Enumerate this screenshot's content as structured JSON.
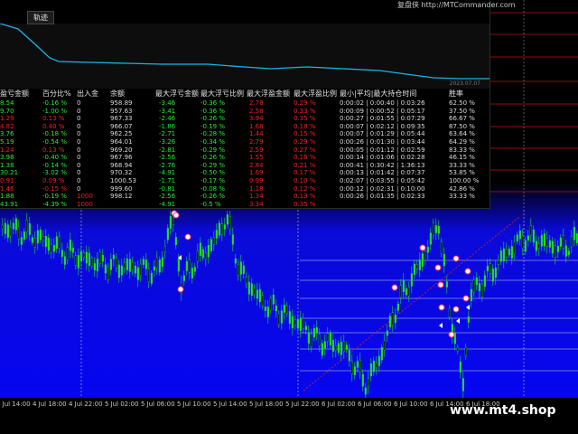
{
  "panel": {
    "title_tab": "轨迹",
    "brand": "复盘侠 http://MTCommander.com",
    "curve_date": "2023.07.07"
  },
  "stats": {
    "headers": [
      "盈亏金额",
      "百分比%",
      "出入金",
      "余额",
      "最大浮亏金额",
      "最大浮亏比例",
      "最大浮盈金额",
      "最大浮盈比例",
      "最小|平均|最大持仓时间",
      "胜率"
    ],
    "rows": [
      {
        "pl": "8.54",
        "pct": "-0.16 %",
        "io": "0",
        "bal": "958.89",
        "mfl": "-3.46",
        "mflp": "-0.36 %",
        "mfp": "2.78",
        "mfpp": "0.29 %",
        "time": "0:00:02 | 0:00:40 | 0:03:26",
        "win": "62.50 %",
        "pl_c": "green",
        "pct_c": "green"
      },
      {
        "pl": "9.70",
        "pct": "-1.00 %",
        "io": "0",
        "bal": "957.63",
        "mfl": "-3.41",
        "mflp": "-0.36 %",
        "mfp": "2.58",
        "mfpp": "0.33 %",
        "time": "0:00:09 | 0:00:52 | 0:05:17",
        "win": "37.50 %",
        "pl_c": "green",
        "pct_c": "green"
      },
      {
        "pl": "1.29",
        "pct": "0.13 %",
        "io": "0",
        "bal": "967.33",
        "mfl": "-2.46",
        "mflp": "-0.26 %",
        "mfp": "3.94",
        "mfpp": "0.35 %",
        "time": "0:00:27 | 0:01:55 | 0:07:29",
        "win": "66.67 %",
        "pl_c": "red",
        "pct_c": "red"
      },
      {
        "pl": "4.82",
        "pct": "0.40 %",
        "io": "0",
        "bal": "966.07",
        "mfl": "-1.86",
        "mflp": "-0.19 %",
        "mfp": "1.68",
        "mfpp": "0.18 %",
        "time": "0:00:07 | 0:02:12 | 0:09:35",
        "win": "87.50 %",
        "pl_c": "red",
        "pct_c": "red"
      },
      {
        "pl": "3.76",
        "pct": "-0.18 %",
        "io": "0",
        "bal": "962.25",
        "mfl": "-2.71",
        "mflp": "-0.28 %",
        "mfp": "1.44",
        "mfpp": "0.15 %",
        "time": "0:00:07 | 0:01:29 | 0:05:44",
        "win": "63.64 %",
        "pl_c": "green",
        "pct_c": "green"
      },
      {
        "pl": "5.19",
        "pct": "-0.54 %",
        "io": "0",
        "bal": "964.01",
        "mfl": "-3.26",
        "mflp": "-0.34 %",
        "mfp": "2.79",
        "mfpp": "0.29 %",
        "time": "0:00:26 | 0:01:30 | 0:03:44",
        "win": "64.29 %",
        "pl_c": "green",
        "pct_c": "green"
      },
      {
        "pl": "1.24",
        "pct": "0.13 %",
        "io": "0",
        "bal": "969.20",
        "mfl": "-2.81",
        "mflp": "-0.29 %",
        "mfp": "2.59",
        "mfpp": "0.27 %",
        "time": "0:00:05 | 0:01:12 | 0:02:59",
        "win": "83.33 %",
        "pl_c": "red",
        "pct_c": "red"
      },
      {
        "pl": "3.98",
        "pct": "-0.40 %",
        "io": "0",
        "bal": "967.96",
        "mfl": "-2.56",
        "mflp": "-0.26 %",
        "mfp": "1.55",
        "mfpp": "0.16 %",
        "time": "0:00:14 | 0:01:06 | 0:02:28",
        "win": "46.15 %",
        "pl_c": "green",
        "pct_c": "green"
      },
      {
        "pl": "1.38",
        "pct": "-0.14 %",
        "io": "0",
        "bal": "968.94",
        "mfl": "-2.76",
        "mflp": "-0.29 %",
        "mfp": "2.84",
        "mfpp": "0.21 %",
        "time": "0:00:41 | 0:30:42 | 1:36:13",
        "win": "33.33 %",
        "pl_c": "green",
        "pct_c": "green"
      },
      {
        "pl": "30.21",
        "pct": "-3.02 %",
        "io": "0",
        "bal": "970.32",
        "mfl": "-4.91",
        "mflp": "-0.50 %",
        "mfp": "1.69",
        "mfpp": "0.17 %",
        "time": "0:00:13 | 0:01:42 | 0:07:37",
        "win": "53.85 %",
        "pl_c": "green",
        "pct_c": "green"
      },
      {
        "pl": "0.91",
        "pct": "0.09 %",
        "io": "0",
        "bal": "1000.53",
        "mfl": "-1.71",
        "mflp": "-0.17 %",
        "mfp": "0.99",
        "mfpp": "0.10 %",
        "time": "0:02:07 | 0:03:55 | 0:05:42",
        "win": "100.00 %",
        "pl_c": "red",
        "pct_c": "red"
      },
      {
        "pl": "1.46",
        "pct": "-0.15 %",
        "io": "0",
        "bal": "999.60",
        "mfl": "-0.81",
        "mflp": "-0.08 %",
        "mfp": "1.18",
        "mfpp": "0.12 %",
        "time": "0:00:12 | 0:02:31 | 0:10:00",
        "win": "42.86 %",
        "pl_c": "red",
        "pct_c": "red"
      },
      {
        "pl": "1.88",
        "pct": "-0.19 %",
        "io": "1000",
        "bal": "998.12",
        "mfl": "-2.56",
        "mflp": "-0.26 %",
        "mfp": "1.34",
        "mfpp": "0.13 %",
        "time": "0:00:26 | 0:01:35 | 0:02:33",
        "win": "33.33 %",
        "pl_c": "green",
        "pct_c": "green"
      },
      {
        "pl": "43.91",
        "pct": "-4.39 %",
        "io": "1000",
        "bal": "",
        "mfl": "-4.91",
        "mflp": "-0.5 %",
        "mfp": "3.34",
        "mfpp": "0.35 %",
        "time": "",
        "win": "",
        "pl_c": "green",
        "pct_c": "green"
      }
    ]
  },
  "time_axis": {
    "labels": [
      "4 Jul 14:00",
      "4 Jul 18:00",
      "4 Jul 22:00",
      "5 Jul 02:00",
      "5 Jul 06:00",
      "5 Jul 10:00",
      "5 Jul 14:00",
      "5 Jul 18:00",
      "5 Jul 22:00",
      "6 Jul 02:00",
      "6 Jul 06:00",
      "6 Jul 10:00",
      "6 Jul 14:00",
      "6 Jul 18:00"
    ]
  },
  "watermark": "www.mt4.shop",
  "colors": {
    "profit_green": "#22ee33",
    "loss_red": "#ee2222",
    "curve": "#19b4e6",
    "candle": "#22dd22",
    "grid_red": "#c01010"
  }
}
